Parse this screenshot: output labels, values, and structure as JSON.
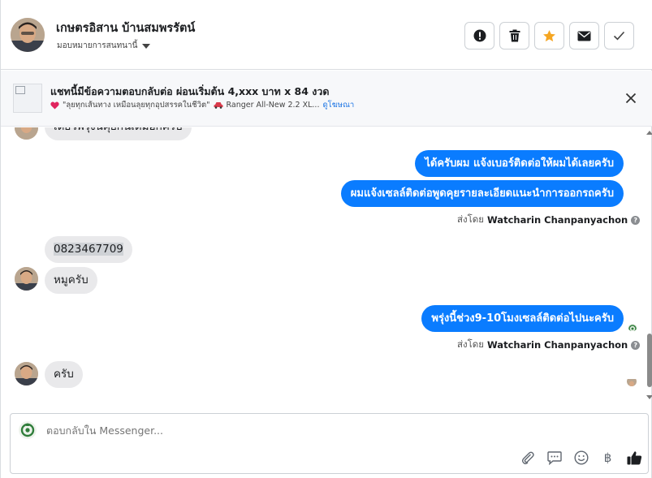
{
  "header": {
    "contact_name": "เกษตรอิสาน บ้านสมพรรัตน์",
    "assign_label": "มอบหมายการสนทนานี้",
    "actions": [
      {
        "icon": "alert-icon",
        "label": "Mark as spam"
      },
      {
        "icon": "trash-icon",
        "label": "Delete"
      },
      {
        "icon": "star-icon",
        "label": "Follow up",
        "color": "#f5a623"
      },
      {
        "icon": "envelope-icon",
        "label": "Mark as unread"
      },
      {
        "icon": "check-icon",
        "label": "Mark as done"
      }
    ]
  },
  "ad_banner": {
    "title": "แชทนี้มีข้อความตอบกลับต่อ ผ่อนเริ่มต้น 4,xxx บาท x 84 งวด",
    "subtitle": "\"ลุยทุกเส้นทาง เหมือนลุยทุกอุปสรรคในชีวิต\"",
    "subtitle_product": "Ranger All-New 2.2 XL...",
    "link_label": "ดูโฆษณา"
  },
  "thread": {
    "partial_top_text": "เดียวพรุ่งนี้คุยกันเต็มอีกครับ",
    "outgoing_1": "ได้ครับผม แจ้งเบอร์ติดต่อให้ผมได้เลยครับ",
    "outgoing_2": "ผมแจ้งเซลล์ติดต่อพูดคุยรายละเอียดแนะนำการออกรถครับ",
    "sent_by_prefix": "ส่งโดย",
    "sent_by_name": "Watcharin Chanpanyachon",
    "incoming_phone": "0823467709",
    "incoming_2": "หมูครับ",
    "outgoing_3": "พรุ่งนี้ช่วง9-10โมงเซลล์ติดต่อไปนะครับ",
    "incoming_3": "ครับ"
  },
  "composer": {
    "placeholder": "ตอบกลับใน Messenger...",
    "tools": [
      "paperclip-icon",
      "chat-bubble-icon",
      "smiley-icon",
      "baht-icon",
      "thumbs-up-icon"
    ],
    "baht_symbol": "฿"
  },
  "colors": {
    "outgoing_bubble": "#0a7cff",
    "incoming_bubble": "#e9e9eb",
    "link": "#1b74e4",
    "star": "#f5a623"
  }
}
